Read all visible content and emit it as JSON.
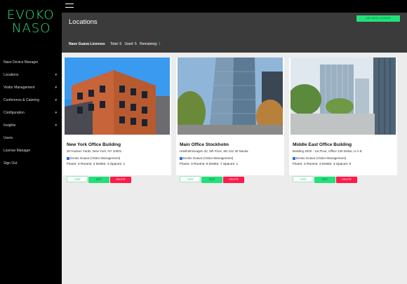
{
  "brand": {
    "line1": "EVOKO",
    "line2": "NASO"
  },
  "sidebar": {
    "items": [
      {
        "label": "Naso Device Manager",
        "chevron": false
      },
      {
        "label": "Locations",
        "chevron": true
      },
      {
        "label": "Visitor Management",
        "chevron": true
      },
      {
        "label": "Conference & Catering",
        "chevron": true
      },
      {
        "label": "Configuration",
        "chevron": true
      },
      {
        "label": "Insights",
        "chevron": true
      },
      {
        "label": "Users",
        "chevron": false
      },
      {
        "label": "License Manager",
        "chevron": false
      },
      {
        "label": "Sign Out",
        "chevron": false
      }
    ],
    "chevron_glyph": "▾"
  },
  "header": {
    "title": "Locations",
    "add_button": "ADD NEW LOCATION",
    "licenses": {
      "label": "Naso Guava Licenses",
      "total_label": "Total:",
      "total_value": "6",
      "used_label": "Used:",
      "used_value": "5",
      "remaining_label": "Remaining:",
      "remaining_value": "1"
    }
  },
  "cards": [
    {
      "name": "New York Office Building",
      "address": "30 Hudson Yards, New York, NY 10001",
      "guava": "Evoko Guava (Visitor Management)",
      "stats": "Floors: 4  Rooms: 4  Desks: 3  Spaces: 1",
      "buttons": {
        "view": "VIEW",
        "edit": "EDIT",
        "delete": "DELETE"
      }
    },
    {
      "name": "Main Office Stockholm",
      "address": "Hastholmsvagen 32, 5th Floor, SE-131 30 Nacka",
      "guava": "Evoko Guava (Visitor Management)",
      "stats": "Floors: 3  Rooms: 6  Desks: 7  Spaces: 1",
      "buttons": {
        "view": "VIEW",
        "edit": "EDIT",
        "delete": "DELETE"
      }
    },
    {
      "name": "Middle East Office Building",
      "address": "Building 2020 - 1st Floor, Office 130 Dubai, U.A.E.",
      "guava": "Evoko Guava (Visitor Management)",
      "stats": "Floors: 2  Rooms: 3  Desks: 3  Spaces: 0",
      "buttons": {
        "view": "VIEW",
        "edit": "EDIT",
        "delete": "DELETE"
      }
    }
  ],
  "colors": {
    "accent": "#23e07a",
    "delete": "#ff1a4a",
    "header": "#3b3b3b",
    "sidebar": "#000000",
    "content": "#ececec"
  },
  "icons": {
    "menu": "hamburger-icon",
    "check": "checkbox-icon",
    "chevron": "chevron-down-icon"
  }
}
